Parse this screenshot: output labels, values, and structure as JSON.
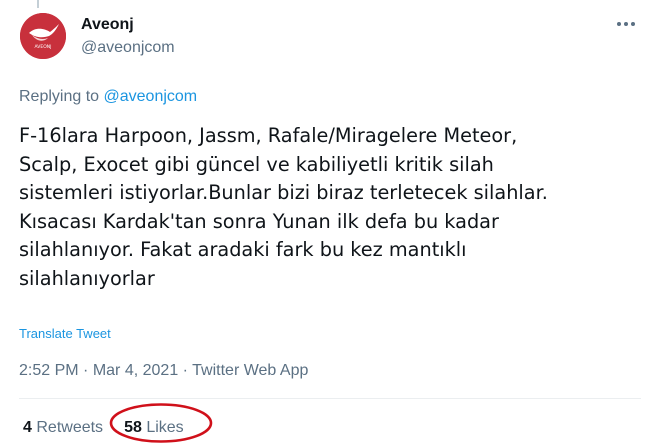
{
  "tweet": {
    "author": {
      "display_name": "Aveonj",
      "handle": "@aveonjcom",
      "avatar_color": "#c8303c",
      "avatar_text": "AVEONJ"
    },
    "replying": {
      "prefix": "Replying to",
      "target": "@aveonjcom"
    },
    "text_lines": [
      "F-16lara Harpoon, Jassm, Rafale/Miragelere Meteor,",
      "Scalp, Exocet gibi güncel ve kabiliyetli kritik silah",
      "sistemleri istiyorlar.Bunlar bizi biraz terletecek silahlar.",
      "Kısacası Kardak'tan sonra Yunan ilk defa bu kadar",
      "silahlanıyor. Fakat aradaki fark bu kez mantıklı",
      "silahlanıyorlar"
    ],
    "translate_label": "Translate Tweet",
    "time": "2:52 PM",
    "date": "Mar 4, 2021",
    "separator": "·",
    "source": "Twitter Web App",
    "stats": {
      "retweets_count": "4",
      "retweets_label": "Retweets",
      "likes_count": "58",
      "likes_label": "Likes"
    }
  },
  "icons": {
    "more": "more-horizontal-icon"
  },
  "annotation": {
    "color": "#d0101a",
    "shape": "ellipse"
  },
  "colors": {
    "text_primary": "#0f1419",
    "text_secondary": "#5b7083",
    "link": "#1b95e0",
    "divider": "#ebeef0"
  }
}
